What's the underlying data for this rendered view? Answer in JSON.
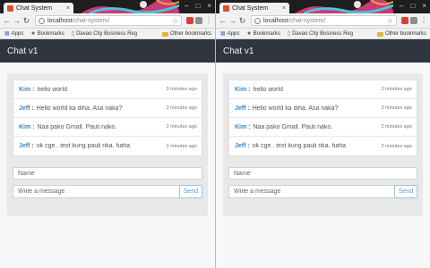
{
  "browser": {
    "tab_title": "Chat System",
    "tab_close": "×",
    "url_host": "localhost",
    "url_path": "/chat-system/",
    "window_controls": [
      "–",
      "□",
      "×"
    ],
    "nav_icons": [
      "back-icon",
      "forward-icon",
      "reload-icon"
    ],
    "accent_colors": {
      "titlebar": "#1e1e1e",
      "favicon": "#d9532f",
      "extension_red": "#d9403a",
      "extension_gray": "#8e8e8e"
    },
    "bookmarks": {
      "apps": "Apps",
      "bookmarks": "Bookmarks",
      "davao": "Davao City Business Reg",
      "other": "Other bookmarks"
    }
  },
  "app": {
    "title": "Chat v1",
    "name_placeholder": "Name",
    "message_placeholder": "Write a message",
    "send_label": "Send",
    "colors": {
      "header_bg": "#2f3640",
      "author": "#3a86c8",
      "send": "#5b9bd5"
    },
    "messages": [
      {
        "author": "Kim :",
        "text": "hello world",
        "time": "3 minutes ago"
      },
      {
        "author": "Jeff :",
        "text": "Hello world ka diha. Asa naka?",
        "time": "3 minutes ago"
      },
      {
        "author": "Kim :",
        "text": "Naa pako Gmall. Pauli nako.",
        "time": "2 minutes ago"
      },
      {
        "author": "Jeff :",
        "text": "ok cge.. text kung pauli nka. haha",
        "time": "2 minutes ago"
      }
    ]
  }
}
